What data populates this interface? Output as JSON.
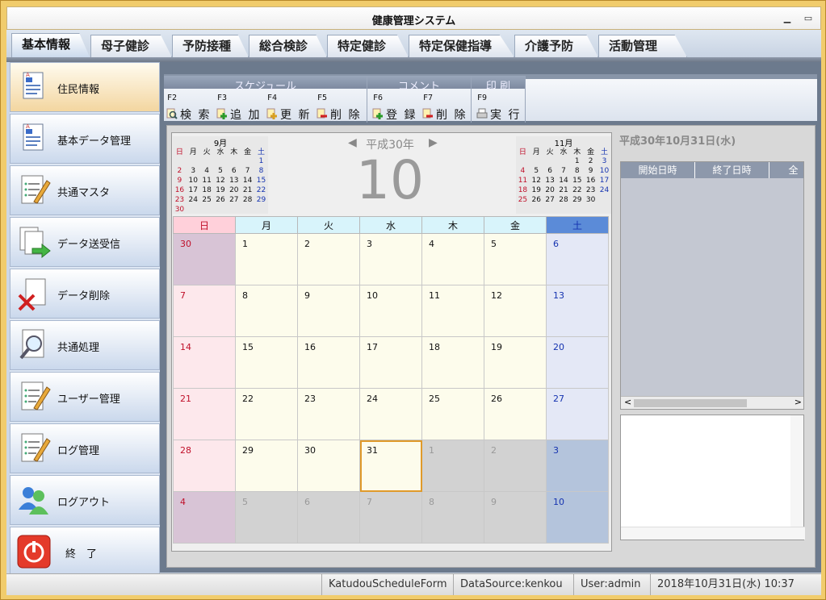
{
  "window": {
    "title": "健康管理システム",
    "min_icon": "minimize-icon",
    "max_icon": "maximize-icon"
  },
  "tabs": [
    "基本情報",
    "母子健診",
    "予防接種",
    "総合検診",
    "特定健診",
    "特定保健指導",
    "介護予防",
    "活動管理"
  ],
  "sidebar": [
    {
      "label": "住民情報",
      "icon": "document-icon"
    },
    {
      "label": "基本データ管理",
      "icon": "document-icon"
    },
    {
      "label": "共通マスタ",
      "icon": "pencil-list-icon"
    },
    {
      "label": "データ送受信",
      "icon": "document-arrow-icon"
    },
    {
      "label": "データ削除",
      "icon": "delete-x-icon"
    },
    {
      "label": "共通処理",
      "icon": "magnifier-icon"
    },
    {
      "label": "ユーザー管理",
      "icon": "pencil-list-icon"
    },
    {
      "label": "ログ管理",
      "icon": "pencil-list-icon"
    },
    {
      "label": "ログアウト",
      "icon": "users-icon"
    },
    {
      "label": "終　了",
      "icon": "power-icon"
    }
  ],
  "toolbar": {
    "groups": [
      "スケジュール",
      "コメント",
      "印 刷"
    ],
    "buttons": [
      {
        "fkey": "F2",
        "label": "検 索",
        "icon": "search-icon"
      },
      {
        "fkey": "F3",
        "label": "追 加",
        "icon": "add-icon"
      },
      {
        "fkey": "F4",
        "label": "更 新",
        "icon": "update-icon"
      },
      {
        "fkey": "F5",
        "label": "削 除",
        "icon": "delete-icon"
      },
      {
        "fkey": "F6",
        "label": "登 録",
        "icon": "add-icon"
      },
      {
        "fkey": "F7",
        "label": "削 除",
        "icon": "delete-icon"
      },
      {
        "fkey": "F9",
        "label": "実 行",
        "icon": "print-icon"
      }
    ]
  },
  "calendar": {
    "era": "平成30年",
    "month": "10",
    "prev": "◀",
    "next": "▶",
    "weekdays": [
      "日",
      "月",
      "火",
      "水",
      "木",
      "金",
      "土"
    ],
    "prev_mini": {
      "title": "9月",
      "weeks": [
        [
          "",
          "",
          "",
          "",
          "",
          "",
          "1"
        ],
        [
          "2",
          "3",
          "4",
          "5",
          "6",
          "7",
          "8"
        ],
        [
          "9",
          "10",
          "11",
          "12",
          "13",
          "14",
          "15"
        ],
        [
          "16",
          "17",
          "18",
          "19",
          "20",
          "21",
          "22"
        ],
        [
          "23",
          "24",
          "25",
          "26",
          "27",
          "28",
          "29"
        ],
        [
          "30",
          "",
          "",
          "",
          "",
          "",
          ""
        ]
      ]
    },
    "next_mini": {
      "title": "11月",
      "weeks": [
        [
          "",
          "",
          "",
          "",
          "1",
          "2",
          "3"
        ],
        [
          "4",
          "5",
          "6",
          "7",
          "8",
          "9",
          "10"
        ],
        [
          "11",
          "12",
          "13",
          "14",
          "15",
          "16",
          "17"
        ],
        [
          "18",
          "19",
          "20",
          "21",
          "22",
          "23",
          "24"
        ],
        [
          "25",
          "26",
          "27",
          "28",
          "29",
          "30",
          ""
        ]
      ]
    },
    "weeks": [
      [
        "30",
        "1",
        "2",
        "3",
        "4",
        "5",
        "6"
      ],
      [
        "7",
        "8",
        "9",
        "10",
        "11",
        "12",
        "13"
      ],
      [
        "14",
        "15",
        "16",
        "17",
        "18",
        "19",
        "20"
      ],
      [
        "21",
        "22",
        "23",
        "24",
        "25",
        "26",
        "27"
      ],
      [
        "28",
        "29",
        "30",
        "31",
        "1",
        "2",
        "3"
      ],
      [
        "4",
        "5",
        "6",
        "7",
        "8",
        "9",
        "10"
      ]
    ],
    "selected": "31"
  },
  "right": {
    "date": "平成30年10月31日(水)",
    "cols": [
      "開始日時",
      "終了日時",
      "全"
    ]
  },
  "status": [
    "KatudouScheduleForm",
    "DataSource:kenkou",
    "User:admin",
    "2018年10月31日(水)  10:37"
  ],
  "colors": {
    "sun_header": "#ffd0da",
    "sat_header": "#5b8bd8",
    "sun_cell": "#fde8ec",
    "sat_cell": "#e4e8f6",
    "weekday": "#fdfcec",
    "other": "#d2d2d2",
    "today_border": "#e09a2a"
  }
}
